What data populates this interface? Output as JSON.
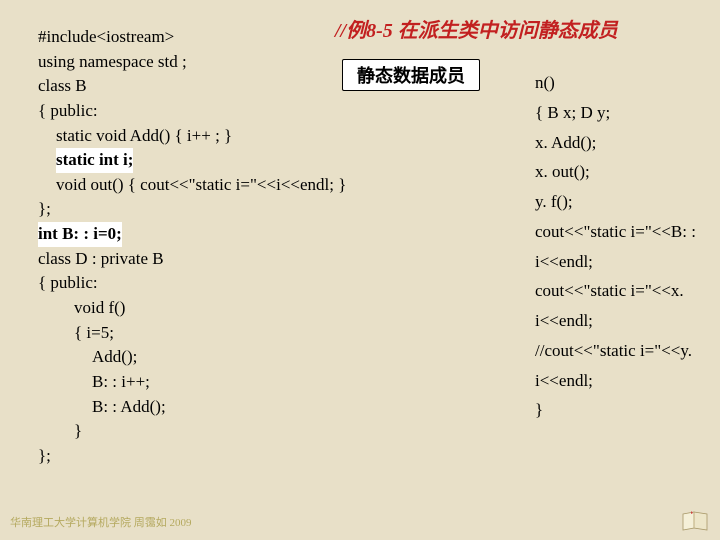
{
  "title": "//例8-5  在派生类中访问静态成员",
  "callout": "静态数据成员",
  "left": {
    "l1": "#include<iostream>",
    "l2": "using namespace std ;",
    "l3": "class B",
    "l4": "{ public:",
    "l5": "static void Add() { i++ ; }",
    "l6": "static int i;",
    "l7": "void out() { cout<<\"static i=\"<<i<<endl; }",
    "l8": "};",
    "l9": "int B: : i=0;",
    "l10": "class D : private B",
    "l11": "{ public:",
    "l12": "void f()",
    "l13": "{ i=5;",
    "l14": "Add();",
    "l15": "B: : i++;",
    "l16": "B: : Add();",
    "l17": "}",
    "l18": "};"
  },
  "right": {
    "r0": "n()",
    "r1": "{ B x;  D y;",
    "r2": "x. Add();",
    "r3": "x. out();",
    "r4": "y. f();",
    "r5": "cout<<\"static i=\"<<B: : i<<endl;",
    "r6": "cout<<\"static i=\"<<x. i<<endl;",
    "r7": "//cout<<\"static i=\"<<y. i<<endl;",
    "r8": "}"
  },
  "footer": "华南理工大学计算机学院 周霭如 2009"
}
